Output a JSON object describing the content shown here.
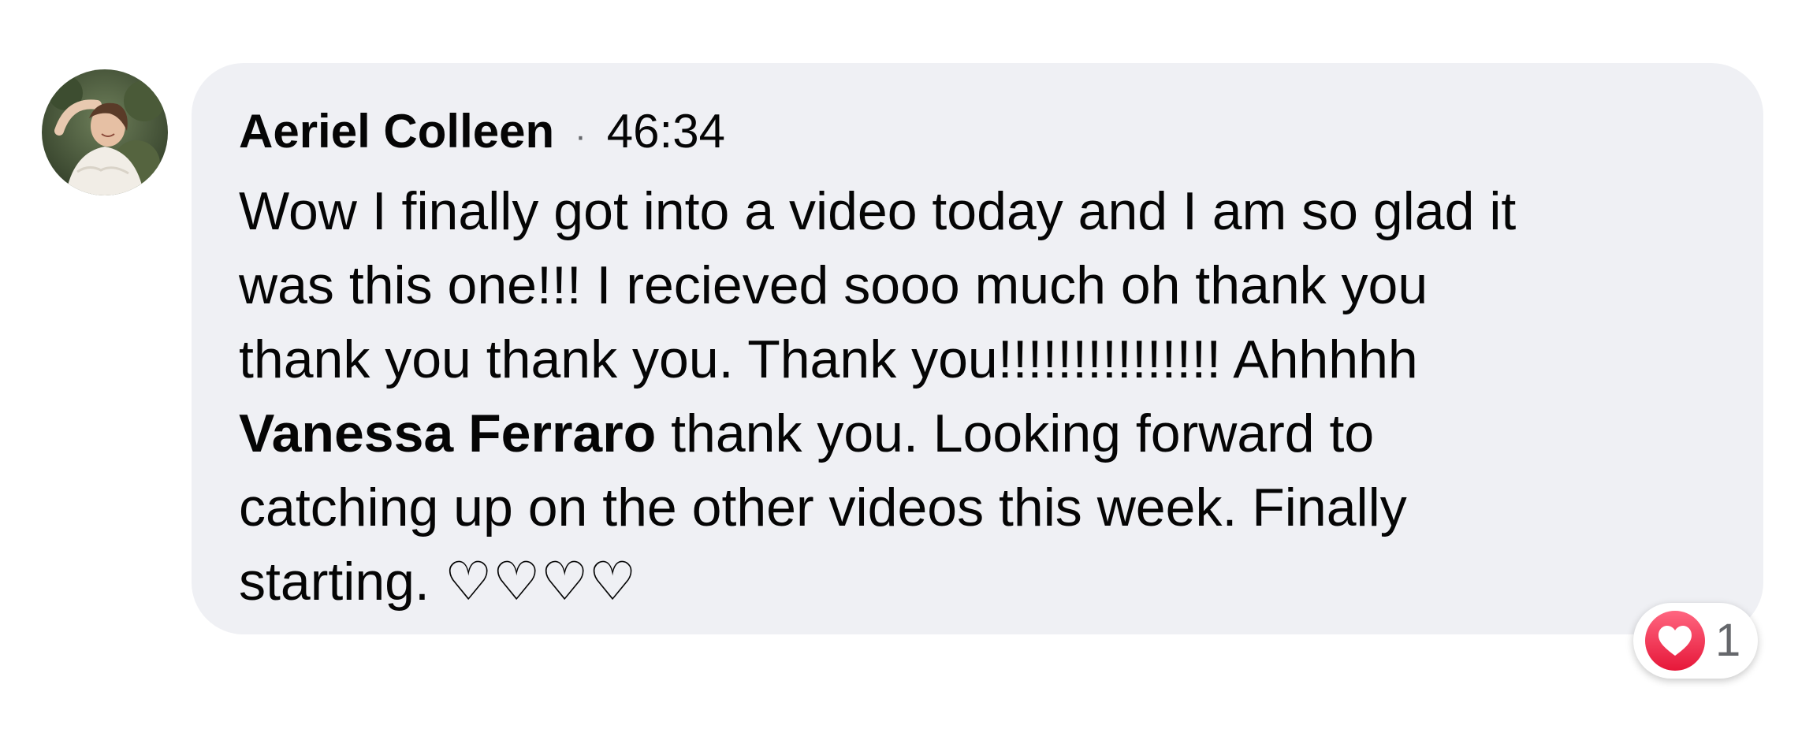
{
  "comment": {
    "author": "Aeriel Colleen",
    "separator": "·",
    "timestamp": "46:34",
    "text_before_mention": "Wow I finally got into a video today and I am so glad it\nwas this one!!! I recieved sooo much oh thank you\nthank you thank you. Thank you!!!!!!!!!!!!!!! Ahhhhh\n",
    "mention": "Vanessa Ferraro",
    "text_after_mention": " thank you. Looking forward to\ncatching up on the other videos this week. Finally\nstarting. ♡♡♡♡",
    "avatar_icon": "user-avatar-photo"
  },
  "reactions": {
    "icon": "love-heart-icon",
    "count": "1",
    "color": "#f33e58"
  },
  "colors": {
    "bubble_background": "#eff0f4",
    "text": "#050505",
    "secondary_text": "#65676b"
  }
}
